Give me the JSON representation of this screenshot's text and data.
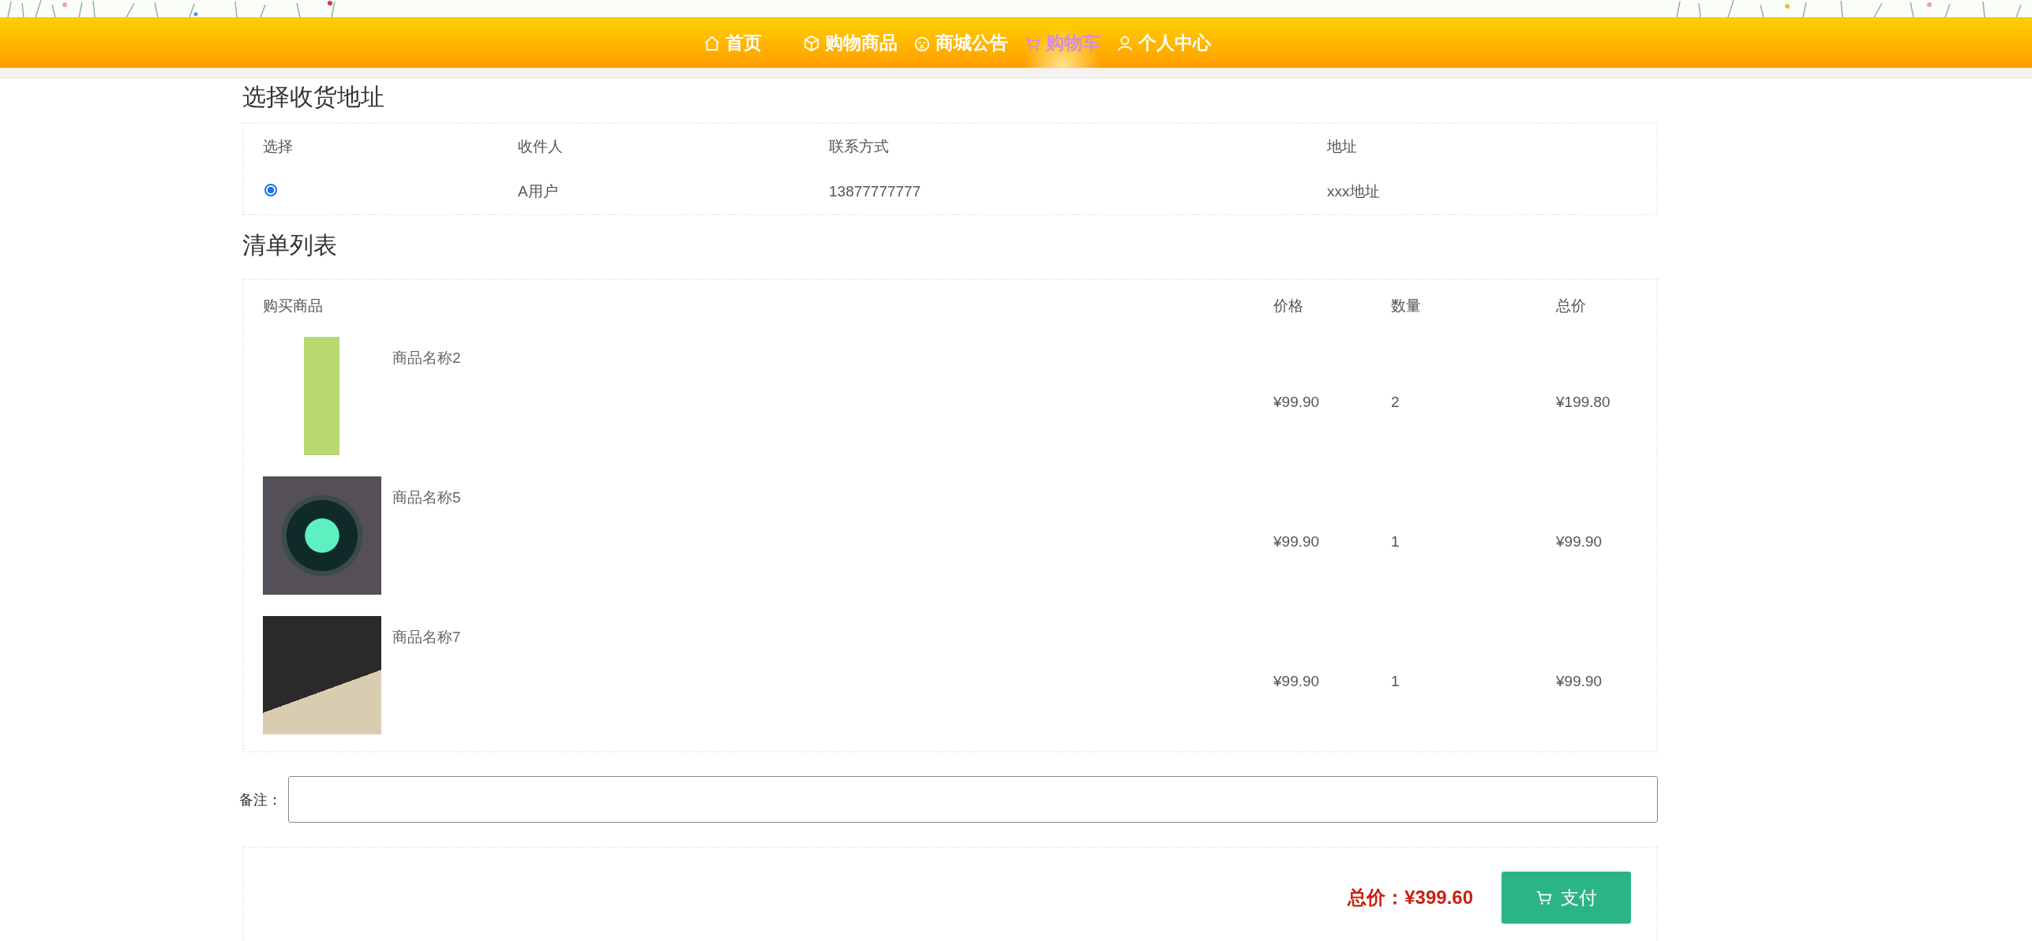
{
  "nav": {
    "items": [
      {
        "label": "首页",
        "selected": false
      },
      {
        "label": "购物商品",
        "selected": false
      },
      {
        "label": "商城公告",
        "selected": false
      },
      {
        "label": "购物车",
        "selected": true
      },
      {
        "label": "个人中心",
        "selected": false
      }
    ]
  },
  "address": {
    "title": "选择收货地址",
    "columns": [
      "选择",
      "收件人",
      "联系方式",
      "地址"
    ],
    "rows": [
      {
        "selected": true,
        "recipient": "A用户",
        "phone": "13877777777",
        "address": "xxx地址"
      }
    ]
  },
  "order_list": {
    "title": "清单列表",
    "columns": [
      "购买商品",
      "价格",
      "数量",
      "总价"
    ],
    "rows": [
      {
        "name": "商品名称2",
        "price": "¥99.90",
        "quantity": "2",
        "total": "¥199.80"
      },
      {
        "name": "商品名称5",
        "price": "¥99.90",
        "quantity": "1",
        "total": "¥99.90"
      },
      {
        "name": "商品名称7",
        "price": "¥99.90",
        "quantity": "1",
        "total": "¥99.90"
      }
    ]
  },
  "remark": {
    "label": "备注："
  },
  "checkout": {
    "total_label": "总价：",
    "total_value": "¥399.60",
    "pay_button": "支付"
  }
}
